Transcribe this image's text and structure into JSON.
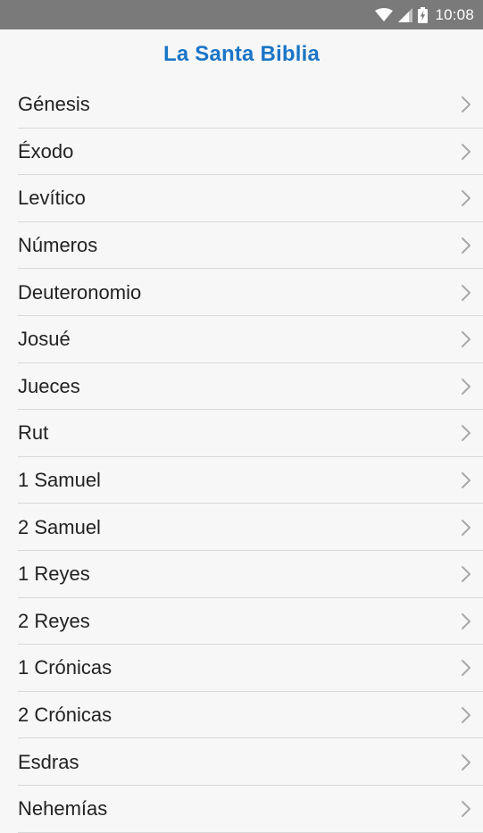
{
  "status_bar": {
    "time": "10:08",
    "icons": [
      "wifi-icon",
      "signal-icon",
      "battery-icon"
    ]
  },
  "header": {
    "title": "La Santa Biblia",
    "title_color": "#1a75c7"
  },
  "books": [
    {
      "name": "Génesis"
    },
    {
      "name": "Éxodo"
    },
    {
      "name": "Levítico"
    },
    {
      "name": "Números"
    },
    {
      "name": "Deuteronomio"
    },
    {
      "name": "Josué"
    },
    {
      "name": "Jueces"
    },
    {
      "name": "Rut"
    },
    {
      "name": "1 Samuel"
    },
    {
      "name": "2 Samuel"
    },
    {
      "name": "1 Reyes"
    },
    {
      "name": "2 Reyes"
    },
    {
      "name": "1 Crónicas"
    },
    {
      "name": "2 Crónicas"
    },
    {
      "name": "Esdras"
    },
    {
      "name": "Nehemías"
    }
  ]
}
